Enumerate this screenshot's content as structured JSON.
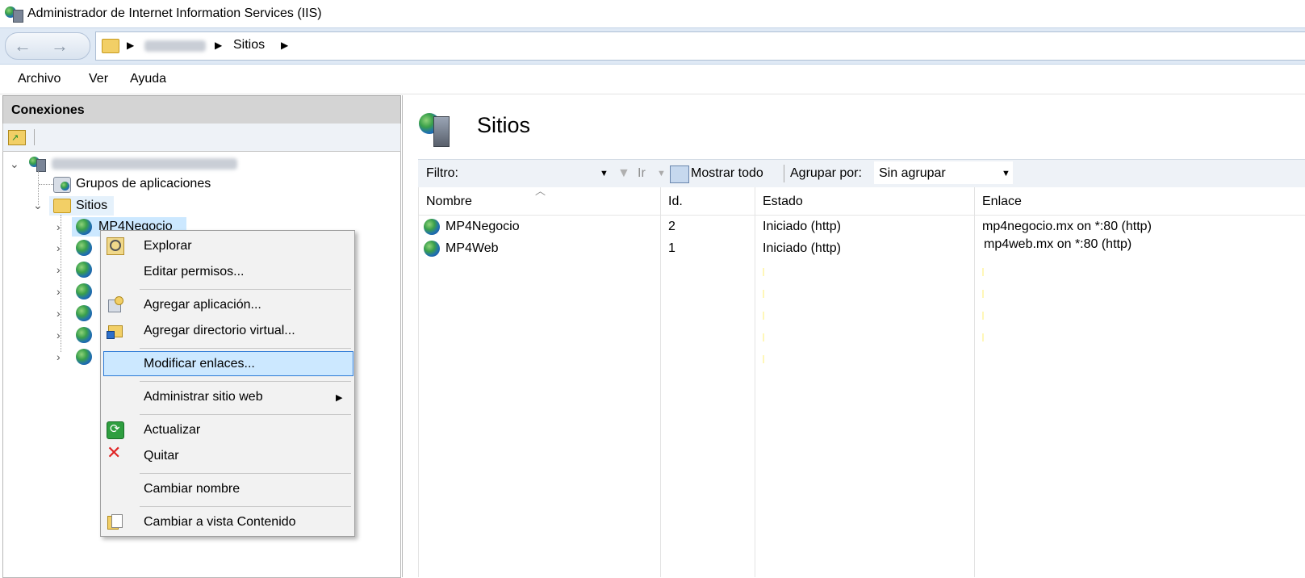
{
  "window": {
    "title": "Administrador de Internet Information Services (IIS)"
  },
  "address": {
    "crumbs": [
      "Sitios"
    ]
  },
  "menu": {
    "items": [
      "Archivo",
      "Ver",
      "Ayuda"
    ]
  },
  "connections": {
    "header": "Conexiones",
    "tree": {
      "app_pools": "Grupos de aplicaciones",
      "sites": "Sitios",
      "selected_site": "MP4Negocio"
    }
  },
  "main": {
    "title": "Sitios",
    "filter": {
      "label": "Filtro:",
      "go": "Ir",
      "show_all": "Mostrar todo",
      "group_by_label": "Agrupar por:",
      "group_by_value": "Sin agrupar"
    },
    "columns": [
      "Nombre",
      "Id.",
      "Estado",
      "Enlace"
    ],
    "rows": [
      {
        "name": "MP4Negocio",
        "id": "2",
        "state": "Iniciado (http)",
        "binding": "mp4negocio.mx on *:80 (http)"
      },
      {
        "name": "MP4Web",
        "id": "1",
        "state": "Iniciado (http)",
        "binding": "mp4web.mx on *:80 (http)"
      }
    ]
  },
  "context_menu": {
    "items": [
      "Explorar",
      "Editar permisos...",
      "Agregar aplicación...",
      "Agregar directorio virtual...",
      "Modificar enlaces...",
      "Administrar sitio web",
      "Actualizar",
      "Quitar",
      "Cambiar nombre",
      "Cambiar a vista Contenido"
    ],
    "highlighted": "Modificar enlaces..."
  },
  "colors": {
    "highlight_bg": "#cce8ff",
    "highlight_border": "#2b79d6",
    "address_bg": "#dfe9f5",
    "remove_icon": "#e02424"
  }
}
